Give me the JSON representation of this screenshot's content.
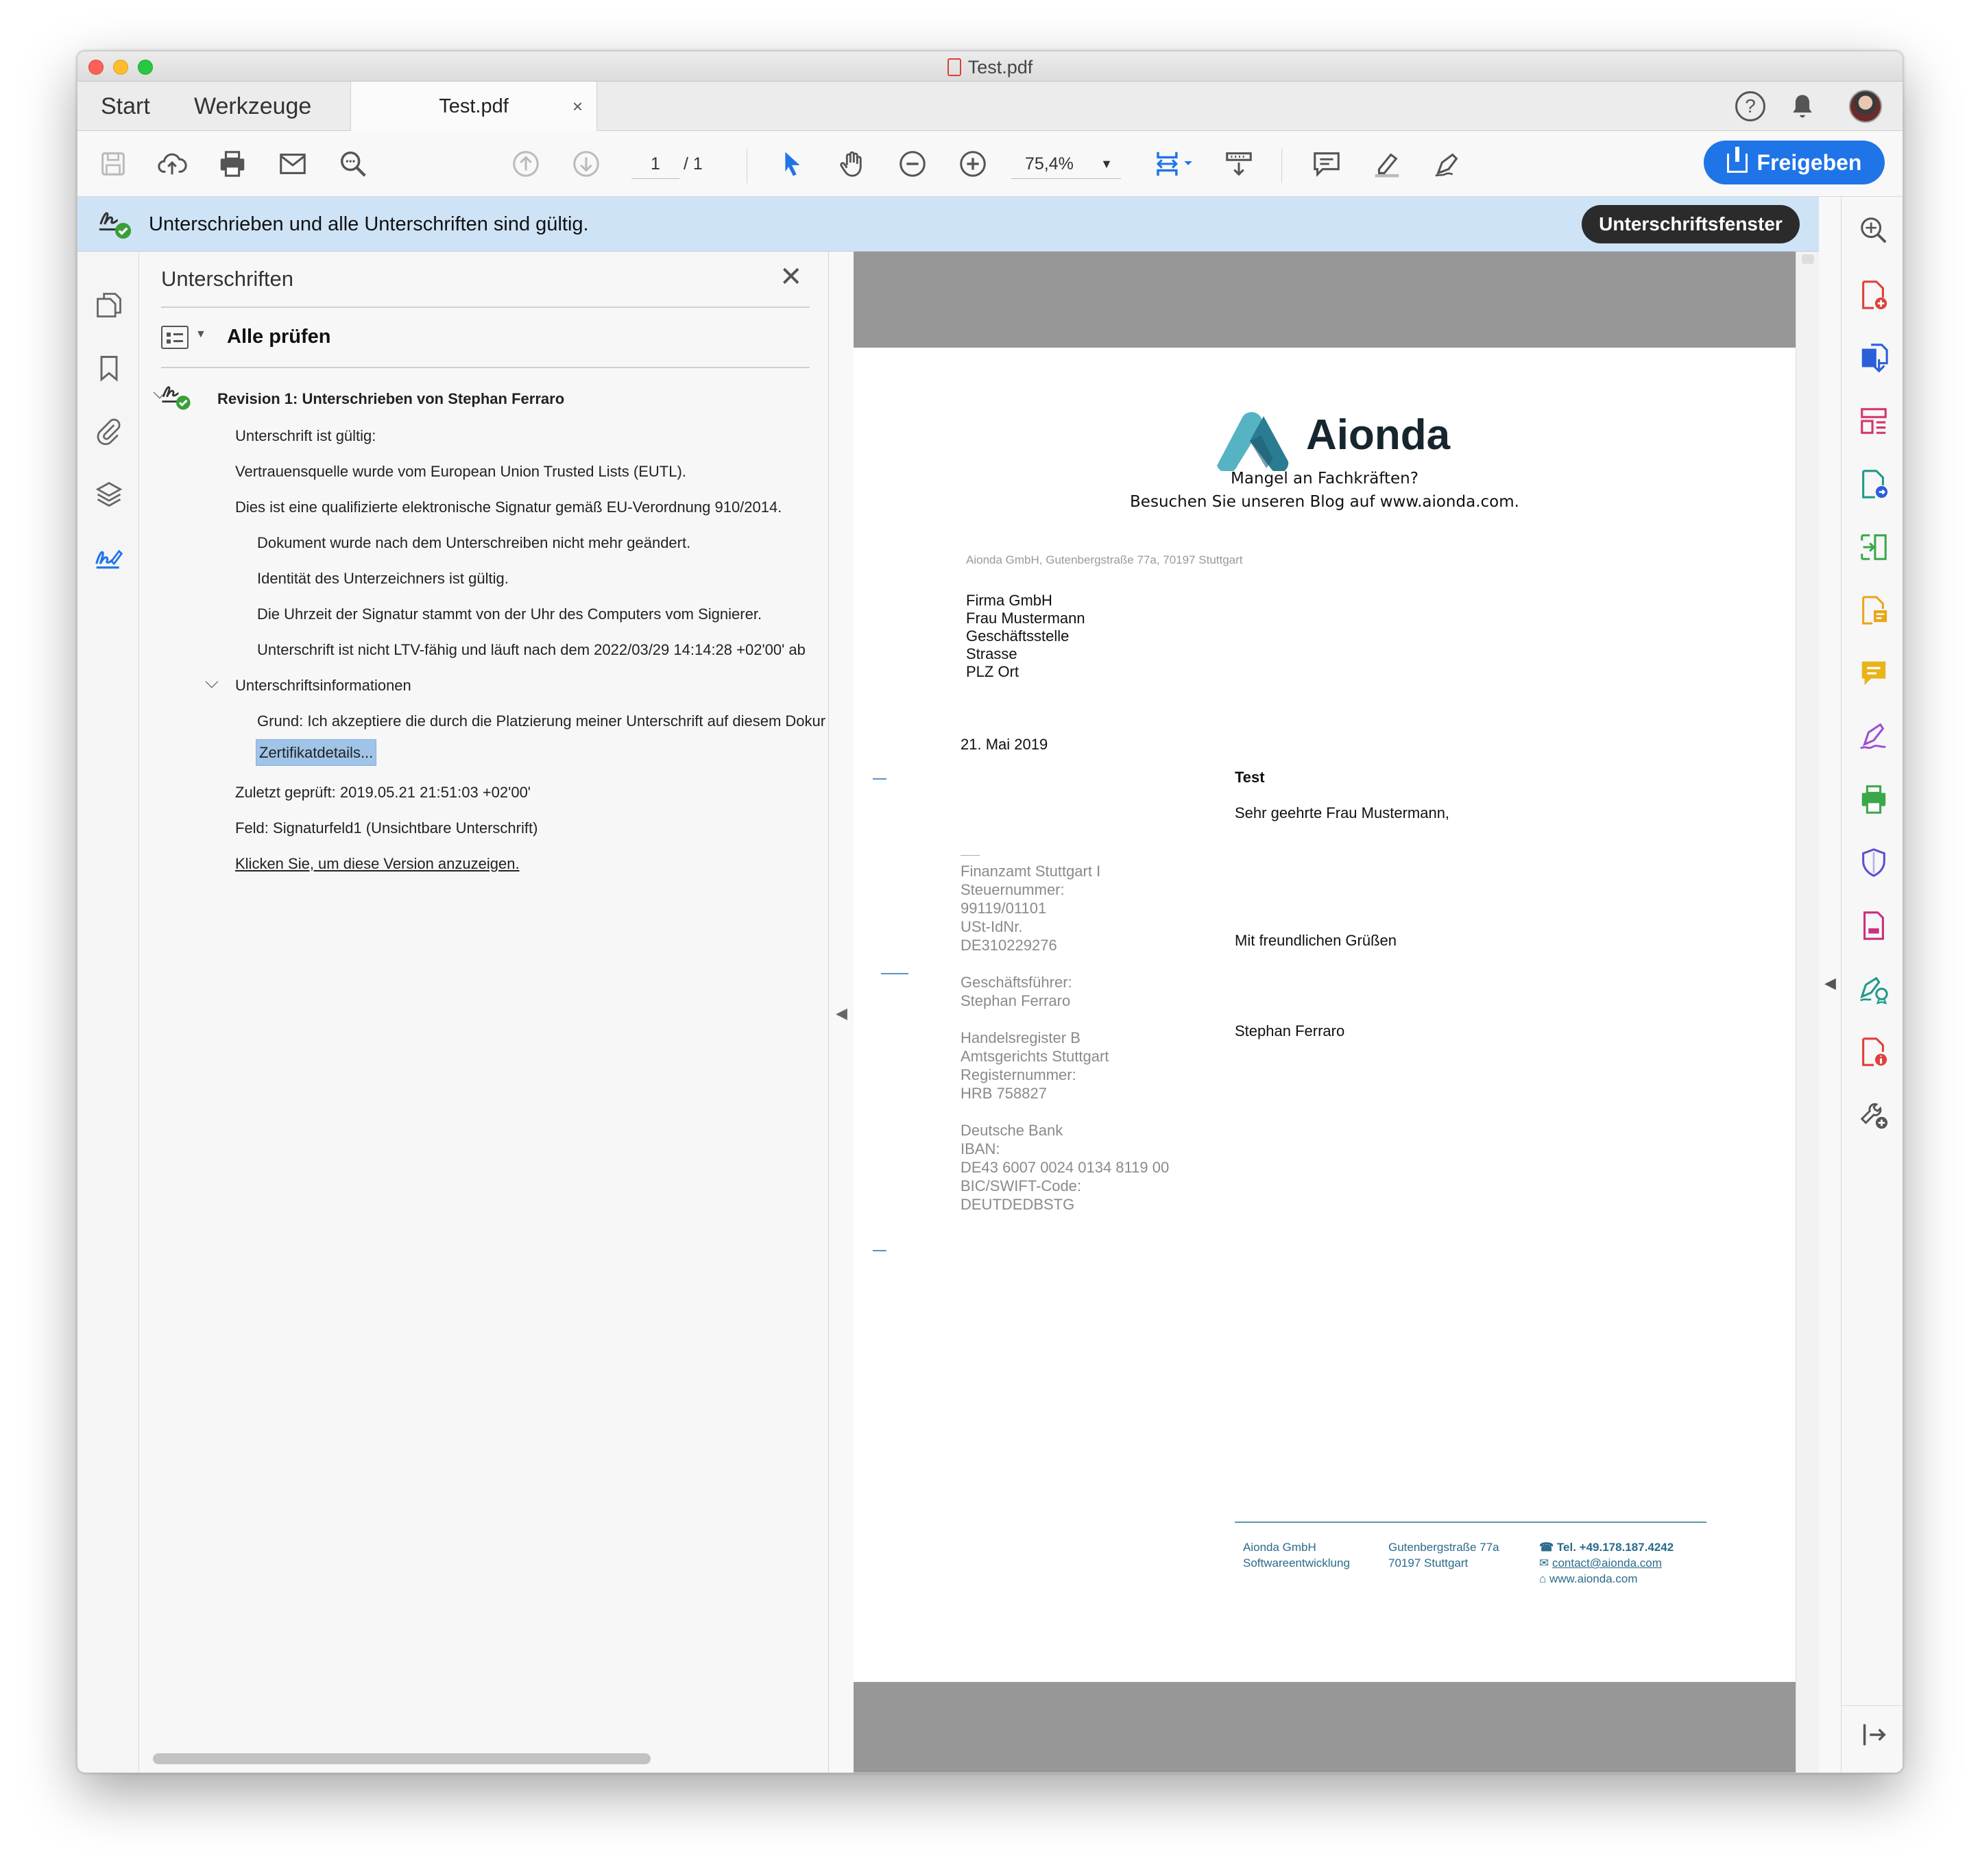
{
  "window": {
    "title": "Test.pdf"
  },
  "tabs": {
    "start": "Start",
    "tools": "Werkzeuge",
    "document": "Test.pdf",
    "close": "×"
  },
  "toolbar": {
    "page_current": "1",
    "page_total": "/ 1",
    "zoom": "75,4%",
    "share": "Freigeben"
  },
  "sigbar": {
    "message": "Unterschrieben und alle Unterschriften sind gültig.",
    "button": "Unterschriftsfenster"
  },
  "panel": {
    "title": "Unterschriften",
    "check_all": "Alle prüfen",
    "revision": "Revision 1: Unterschrieben von Stephan Ferraro",
    "items": [
      "Unterschrift ist gültig:",
      "Vertrauensquelle wurde vom European Union Trusted Lists (EUTL).",
      "Dies ist eine qualifizierte elektronische Signatur gemäß EU-Verordnung 910/2014.",
      "Dokument wurde nach dem Unterschreiben nicht mehr geändert.",
      "Identität des Unterzeichners ist gültig.",
      "Die Uhrzeit der Signatur stammt von der Uhr des Computers vom Signierer.",
      "Unterschrift ist nicht LTV-fähig und läuft nach dem 2022/03/29 14:14:28 +02'00' ab"
    ],
    "info_header": "Unterschriftsinformationen",
    "reason": "Grund: Ich akzeptiere die durch die Platzierung meiner Unterschrift auf diesem Dokur",
    "cert_details": "Zertifikatdetails...",
    "last_checked": "Zuletzt geprüft: 2019.05.21 21:51:03 +02'00'",
    "field": "Feld: Signaturfeld1 (Unsichtbare Unterschrift)",
    "view_version": "Klicken Sie, um diese Version anzuzeigen."
  },
  "doc": {
    "logo": "Aionda",
    "tagline1": "Mangel an Fachkräften?",
    "tagline2": "Besuchen Sie unseren Blog auf www.aionda.com.",
    "sender_line": "Aionda GmbH, Gutenbergstraße 77a, 70197 Stuttgart",
    "recipient": [
      "Firma GmbH",
      "Frau Mustermann",
      "Geschäftsstelle",
      "Strasse",
      "PLZ Ort"
    ],
    "date": "21. Mai 2019",
    "subject": "Test",
    "salutation": "Sehr geehrte Frau Mustermann,",
    "sidebar_info": "Finanzamt Stuttgart I\nSteuernummer:\n99119/01101\nUSt-IdNr.\nDE310229276\n\nGeschäftsführer:\nStephan Ferraro\n\nHandelsregister B\nAmtsgerichts Stuttgart\nRegisternummer:\nHRB 758827\n\nDeutsche Bank\nIBAN:\nDE43 6007 0024 0134 8119 00\nBIC/SWIFT-Code:\nDEUTDEDBSTG",
    "closing": "Mit freundlichen Grüßen",
    "signature_name": "Stephan Ferraro",
    "footer_col1": "Aionda GmbH\nSoftwareentwicklung",
    "footer_col2": "Gutenbergstraße 77a\n70197 Stuttgart",
    "footer_tel": "Tel. +49.178.187.4242",
    "footer_email": "contact@aionda.com",
    "footer_web": "www.aionda.com"
  },
  "colors": {
    "accent": "#1f74e8",
    "sigbar": "#cfe3f7",
    "valid": "#3a9f3a"
  }
}
